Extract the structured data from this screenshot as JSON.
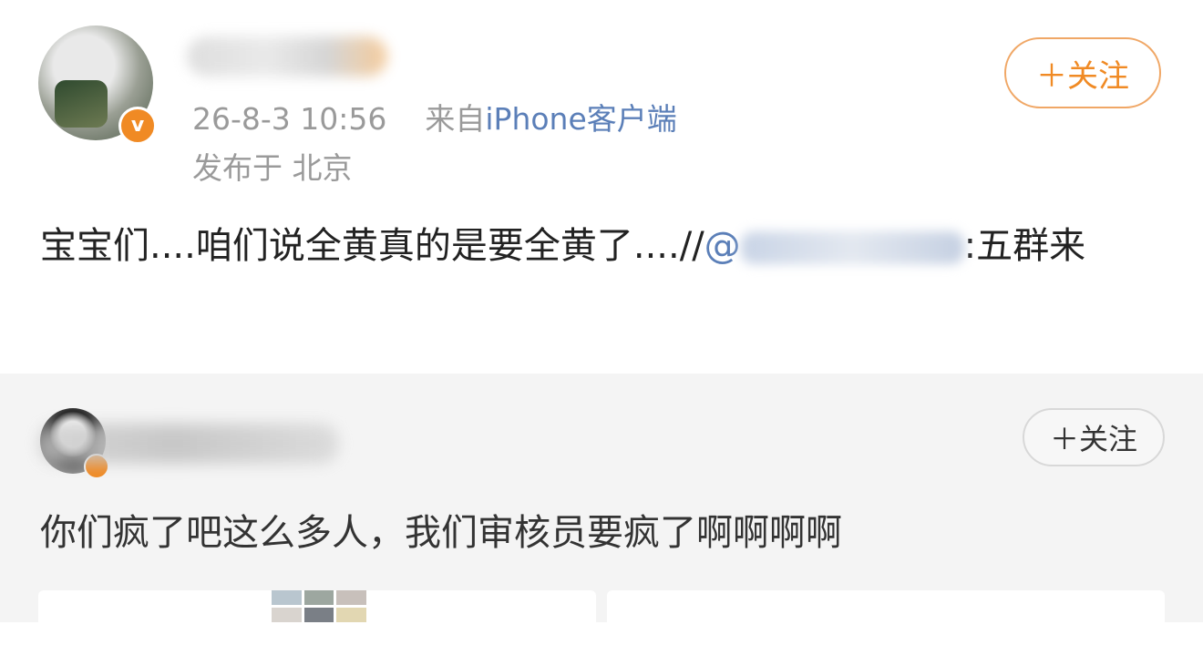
{
  "post": {
    "meta": {
      "time": "26-8-3 10:56",
      "from_prefix": "来自",
      "source": "iPhone客户端",
      "location": "发布于 北京"
    },
    "follow_label": "＋关注",
    "text_before_mention": "宝宝们....咱们说全黄真的是要全黄了....//",
    "mention_at": "@",
    "text_after_mention": ":五群来",
    "badge": "v"
  },
  "repost": {
    "follow_label": "＋关注",
    "text": "你们疯了吧这么多人，我们审核员要疯了啊啊啊啊"
  },
  "colors": {
    "accent": "#f08a24",
    "link": "#5b7fb8",
    "meta_gray": "#9a9a9a",
    "repost_bg": "#f4f4f4"
  }
}
